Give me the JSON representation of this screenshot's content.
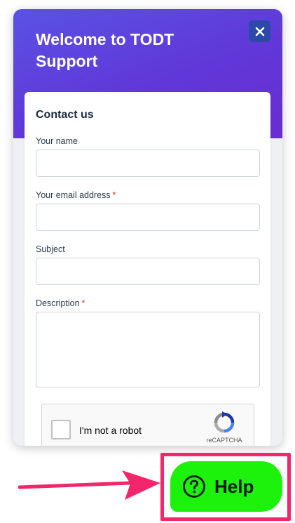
{
  "widget": {
    "title": "Welcome to TODT Support",
    "close_icon": "close-icon"
  },
  "form": {
    "heading": "Contact us",
    "fields": [
      {
        "label": "Your name",
        "required": false,
        "value": "",
        "type": "text"
      },
      {
        "label": "Your email address",
        "required": true,
        "value": "",
        "type": "email"
      },
      {
        "label": "Subject",
        "required": false,
        "value": "",
        "type": "text"
      },
      {
        "label": "Description",
        "required": true,
        "value": "",
        "type": "textarea"
      }
    ],
    "required_marker": "*"
  },
  "recaptcha": {
    "label": "I'm not a robot",
    "brand": "reCAPTCHA",
    "checked": false
  },
  "help_button": {
    "label": "Help",
    "icon": "question-circle-icon",
    "color": "#1cf20c"
  },
  "colors": {
    "header_gradient_start": "#5a52e4",
    "header_gradient_end": "#6a2cd0",
    "close_button": "#2c48a8",
    "annotation": "#f4266b",
    "required": "#d62c2c"
  }
}
